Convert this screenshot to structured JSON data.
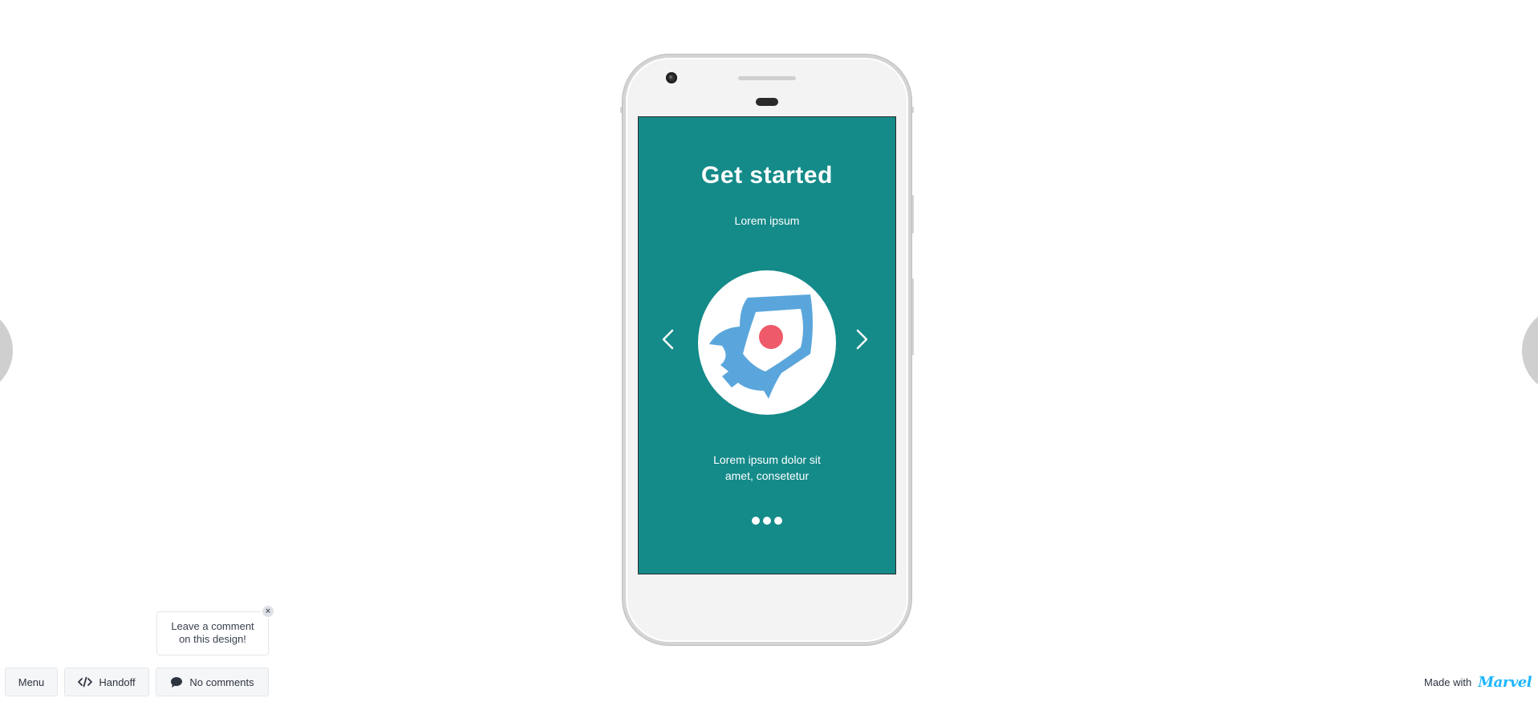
{
  "screen": {
    "title": "Get started",
    "subtitle": "Lorem ipsum",
    "body_line1": "Lorem ipsum dolor sit",
    "body_line2": "amet, consetetur",
    "page_indicator": {
      "total": 3
    }
  },
  "tooltip": {
    "line1": "Leave a comment",
    "line2": "on this design!",
    "close_label": "×"
  },
  "toolbar": {
    "menu_label": "Menu",
    "handoff_label": "Handoff",
    "comments_label": "No comments"
  },
  "branding": {
    "made_with_label": "Made with",
    "logo_text": "Marvel"
  },
  "colors": {
    "screen_bg": "#148a89",
    "rocket_blue": "#5aa6dc",
    "rocket_window": "#ef5a6a",
    "marvel_blue": "#1fb6ff"
  },
  "icons": {
    "prev": "chevron-left-icon",
    "next": "chevron-right-icon",
    "handoff": "code-icon",
    "comments": "speech-bubble-icon",
    "illustration": "rocket-icon"
  }
}
